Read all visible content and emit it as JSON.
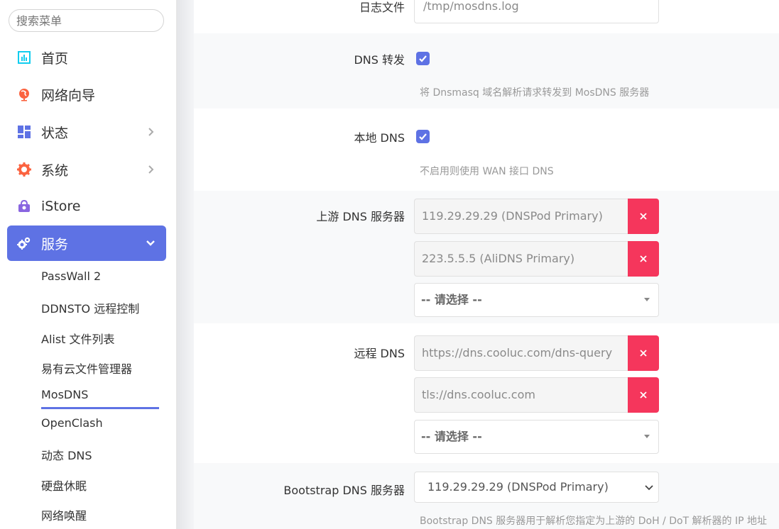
{
  "sidebar": {
    "search_placeholder": "搜索菜单",
    "items": [
      {
        "label": "首页"
      },
      {
        "label": "网络向导"
      },
      {
        "label": "状态"
      },
      {
        "label": "系统"
      },
      {
        "label": "iStore"
      },
      {
        "label": "服务"
      }
    ],
    "sub_items": [
      {
        "label": "PassWall 2"
      },
      {
        "label": "DDNSTO 远程控制"
      },
      {
        "label": "Alist 文件列表"
      },
      {
        "label": "易有云文件管理器"
      },
      {
        "label": "MosDNS"
      },
      {
        "label": "OpenClash"
      },
      {
        "label": "动态 DNS"
      },
      {
        "label": "硬盘休眠"
      },
      {
        "label": "网络唤醒"
      }
    ],
    "accent": "#5e72e4"
  },
  "form": {
    "log_file": {
      "label": "日志文件",
      "value": "/tmp/mosdns.log"
    },
    "dns_forward": {
      "label": "DNS 转发",
      "hint": "将 Dnsmasq 域名解析请求转发到 MosDNS 服务器",
      "checked": true
    },
    "local_dns": {
      "label": "本地 DNS",
      "hint": "不启用则使用 WAN 接口 DNS",
      "checked": true
    },
    "upstream_dns": {
      "label": "上游 DNS 服务器",
      "values": [
        "119.29.29.29 (DNSPod Primary)",
        "223.5.5.5 (AliDNS Primary)"
      ],
      "select_placeholder": "-- 请选择 --"
    },
    "remote_dns": {
      "label": "远程 DNS",
      "values": [
        "https://dns.cooluc.com/dns-query",
        "tls://dns.cooluc.com"
      ],
      "select_placeholder": "-- 请选择 --"
    },
    "bootstrap_dns": {
      "label": "Bootstrap DNS 服务器",
      "value": "119.29.29.29 (DNSPod Primary)",
      "hint": "Bootstrap DNS 服务器用于解析您指定为上游的 DoH / DoT 解析器的 IP 地址"
    },
    "delete_color": "#f5365c"
  }
}
